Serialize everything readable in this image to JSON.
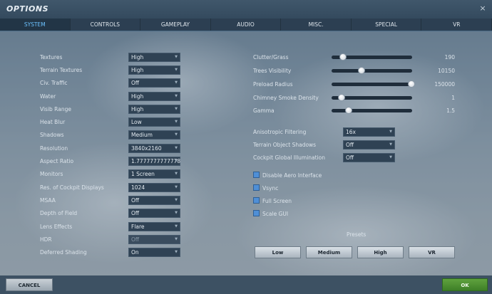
{
  "window": {
    "title": "OPTIONS",
    "close_label": "×"
  },
  "tabs": [
    {
      "label": "SYSTEM",
      "active": true
    },
    {
      "label": "CONTROLS",
      "active": false
    },
    {
      "label": "GAMEPLAY",
      "active": false
    },
    {
      "label": "AUDIO",
      "active": false
    },
    {
      "label": "MISC.",
      "active": false
    },
    {
      "label": "SPECIAL",
      "active": false
    },
    {
      "label": "VR",
      "active": false
    }
  ],
  "left_settings": [
    {
      "label": "Textures",
      "value": "High"
    },
    {
      "label": "Terrain Textures",
      "value": "High"
    },
    {
      "label": "Civ. Traffic",
      "value": "Off"
    },
    {
      "label": "Water",
      "value": "High"
    },
    {
      "label": "Visib Range",
      "value": "High"
    },
    {
      "label": "Heat Blur",
      "value": "Low"
    },
    {
      "label": "Shadows",
      "value": "Medium"
    },
    {
      "label": "Resolution",
      "value": "3840x2160"
    },
    {
      "label": "Aspect Ratio",
      "value": "1.7777777777778"
    },
    {
      "label": "Monitors",
      "value": "1 Screen"
    },
    {
      "label": "Res. of Cockpit Displays",
      "value": "1024"
    },
    {
      "label": "MSAA",
      "value": "Off"
    },
    {
      "label": "Depth of Field",
      "value": "Off"
    },
    {
      "label": "Lens Effects",
      "value": "Flare"
    },
    {
      "label": "HDR",
      "value": "Off",
      "disabled": true
    },
    {
      "label": "Deferred Shading",
      "value": "On"
    }
  ],
  "sliders": [
    {
      "label": "Clutter/Grass",
      "value": "190",
      "level": 0.14
    },
    {
      "label": "Trees Visibility",
      "value": "10150",
      "level": 0.37
    },
    {
      "label": "Preload Radius",
      "value": "150000",
      "level": 0.99
    },
    {
      "label": "Chimney Smoke Density",
      "value": "1",
      "level": 0.12
    },
    {
      "label": "Gamma",
      "value": "1.5",
      "level": 0.21
    }
  ],
  "right_dropdowns": [
    {
      "label": "Anisotropic Filtering",
      "value": "16x"
    },
    {
      "label": "Terrain Object Shadows",
      "value": "Off"
    },
    {
      "label": "Cockpit Global Illumination",
      "value": "Off"
    }
  ],
  "checkboxes": [
    {
      "label": "Disable Aero Interface",
      "checked": false
    },
    {
      "label": "Vsync",
      "checked": false
    },
    {
      "label": "Full Screen",
      "checked": false
    },
    {
      "label": "Scale GUI",
      "checked": false
    }
  ],
  "presets": {
    "title": "Presets",
    "buttons": [
      "Low",
      "Medium",
      "High",
      "VR"
    ]
  },
  "footer": {
    "cancel_label": "CANCEL",
    "ok_label": "OK"
  },
  "colors": {
    "accent_tab": "#6cc2ff",
    "checkbox": "#4f8fd6",
    "ok": "#4f932f"
  }
}
